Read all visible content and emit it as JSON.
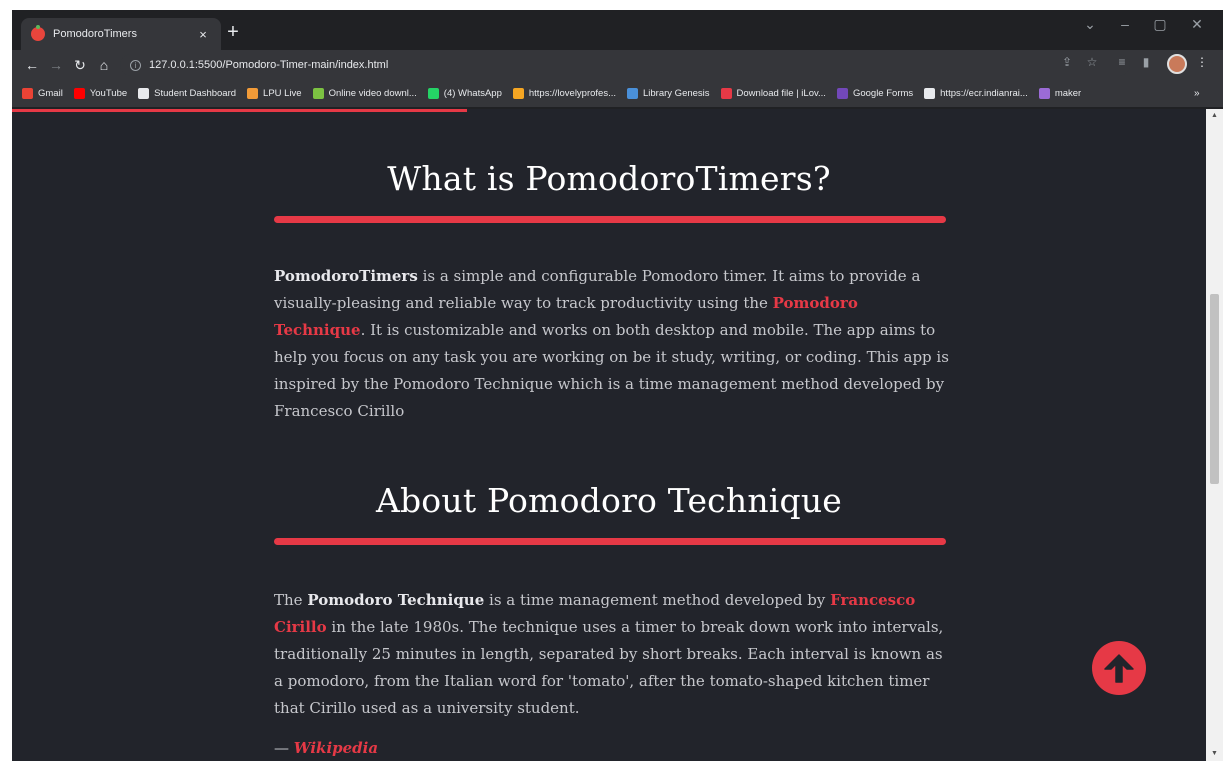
{
  "browser": {
    "tab_title": "PomodoroTimers",
    "tab_close": "×",
    "new_tab": "+",
    "url": "127.0.0.1:5500/Pomodoro-Timer-main/index.html",
    "controls": {
      "dropdown": "⌄",
      "minimize": "–",
      "maximize": "▢",
      "close": "✕"
    },
    "nav": {
      "back": "←",
      "forward": "→",
      "reload": "↻",
      "home": "⌂"
    },
    "bookmarks": [
      {
        "label": "Gmail",
        "color": "#ea4335"
      },
      {
        "label": "YouTube",
        "color": "#ff0000"
      },
      {
        "label": "Student Dashboard",
        "color": "#e8eaed"
      },
      {
        "label": "LPU Live",
        "color": "#f29b38"
      },
      {
        "label": "Online video downl...",
        "color": "#7cc242"
      },
      {
        "label": "(4) WhatsApp",
        "color": "#25d366"
      },
      {
        "label": "https://lovelyprofes...",
        "color": "#f5a623"
      },
      {
        "label": "Library Genesis",
        "color": "#4a90d9"
      },
      {
        "label": "Download file | iLov...",
        "color": "#e63946"
      },
      {
        "label": "Google Forms",
        "color": "#7248b9"
      },
      {
        "label": "https://ecr.indianrai...",
        "color": "#e8eaed"
      },
      {
        "label": "maker",
        "color": "#9b6bd6"
      }
    ],
    "bookmarks_more": "»"
  },
  "page": {
    "accent": "#e63946",
    "section1": {
      "title": "What is PomodoroTimers?",
      "brand": "PomodoroTimers",
      "t1": " is a simple and configurable Pomodoro timer. It aims to provide a visually-pleasing and reliable way to track productivity using the ",
      "link": "Pomodoro Technique",
      "t2": ". It is customizable and works on both desktop and mobile. The app aims to help you focus on any task you are working on be it study, writing, or coding. This app is inspired by the Pomodoro Technique which is a time management method developed by Francesco Cirillo"
    },
    "section2": {
      "title": "About Pomodoro Technique",
      "t0": "The ",
      "bold": "Pomodoro Technique",
      "t1": " is a time management method developed by ",
      "link": "Francesco Cirillo",
      "t2": " in the late 1980s. The technique uses a timer to break down work into intervals, traditionally 25 minutes in length, separated by short breaks. Each interval is known as a pomodoro, from the Italian word for 'tomato', after the tomato-shaped kitchen timer that Cirillo used as a university student.",
      "attribution_dash": "— ",
      "attribution_source": "Wikipedia"
    }
  }
}
